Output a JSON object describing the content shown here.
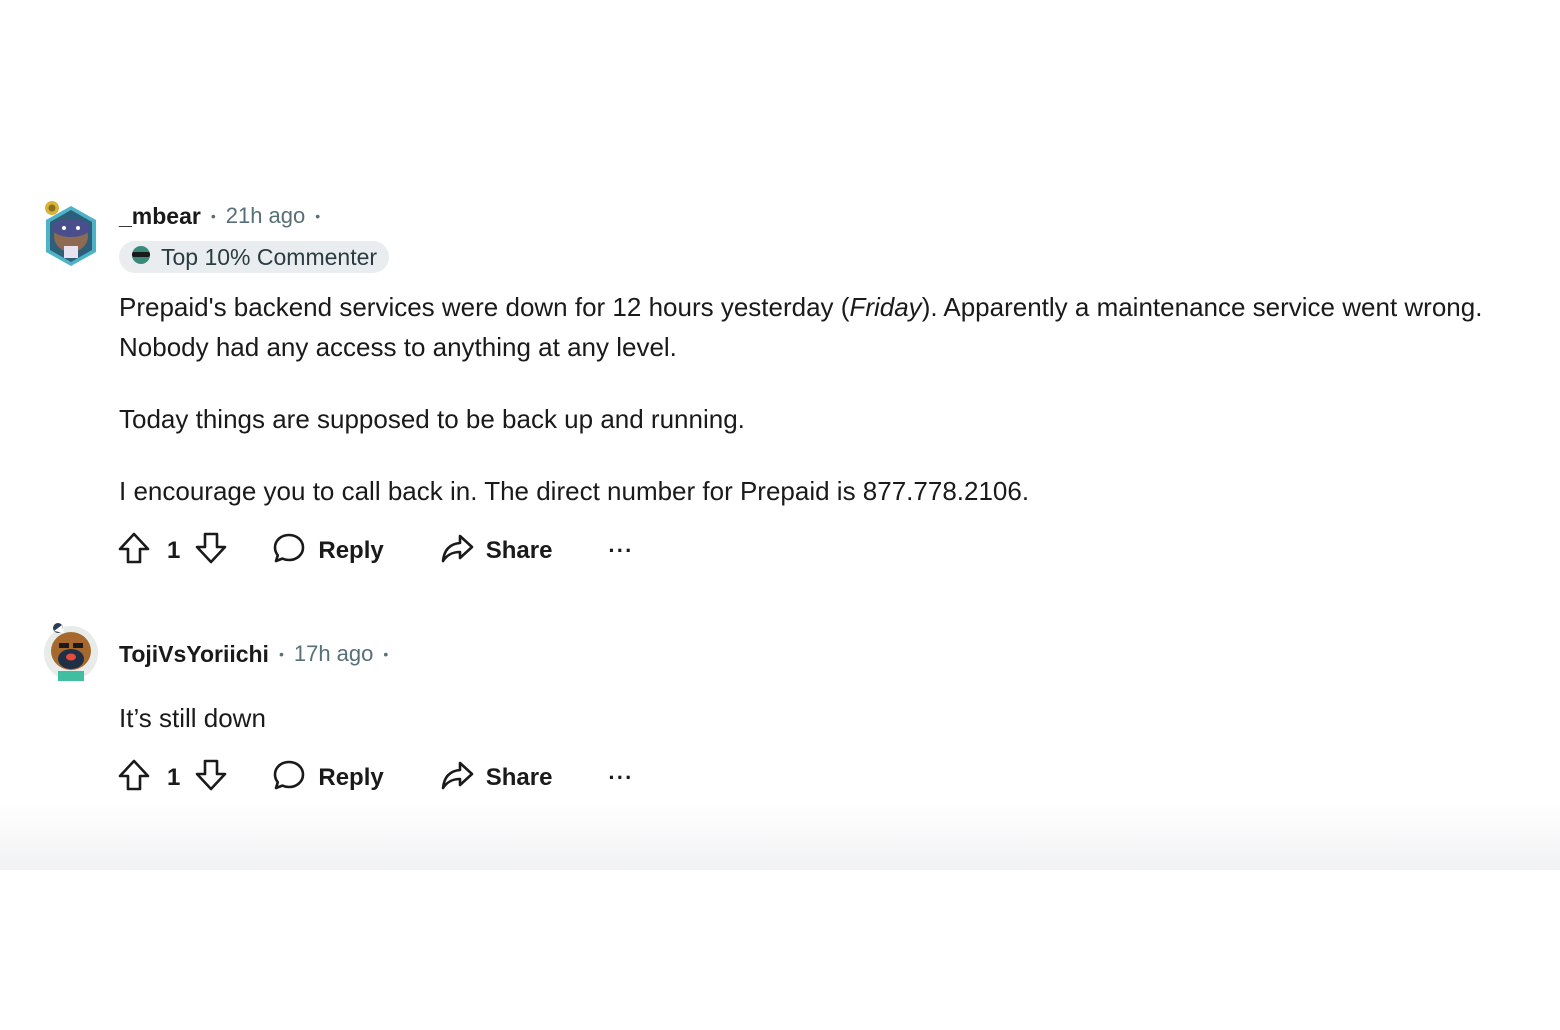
{
  "comments": [
    {
      "username": "_mbear",
      "timestamp": "21h ago",
      "badge": "Top 10% Commenter",
      "body": {
        "p1_before": "Prepaid's backend services were down for 12 hours yesterday (",
        "p1_italic": "Friday",
        "p1_after": "). Apparently a maintenance service went wrong. Nobody had any access to anything at any level.",
        "p2": "Today things are supposed to be back up and running.",
        "p3": "I encourage you to call back in. The direct number for Prepaid is 877.778.2106."
      },
      "votes": "1",
      "reply_label": "Reply",
      "share_label": "Share",
      "more_label": "···"
    },
    {
      "username": "TojiVsYoriichi",
      "timestamp": "17h ago",
      "body": {
        "p1": "It’s still down"
      },
      "votes": "1",
      "reply_label": "Reply",
      "share_label": "Share",
      "more_label": "···"
    }
  ]
}
